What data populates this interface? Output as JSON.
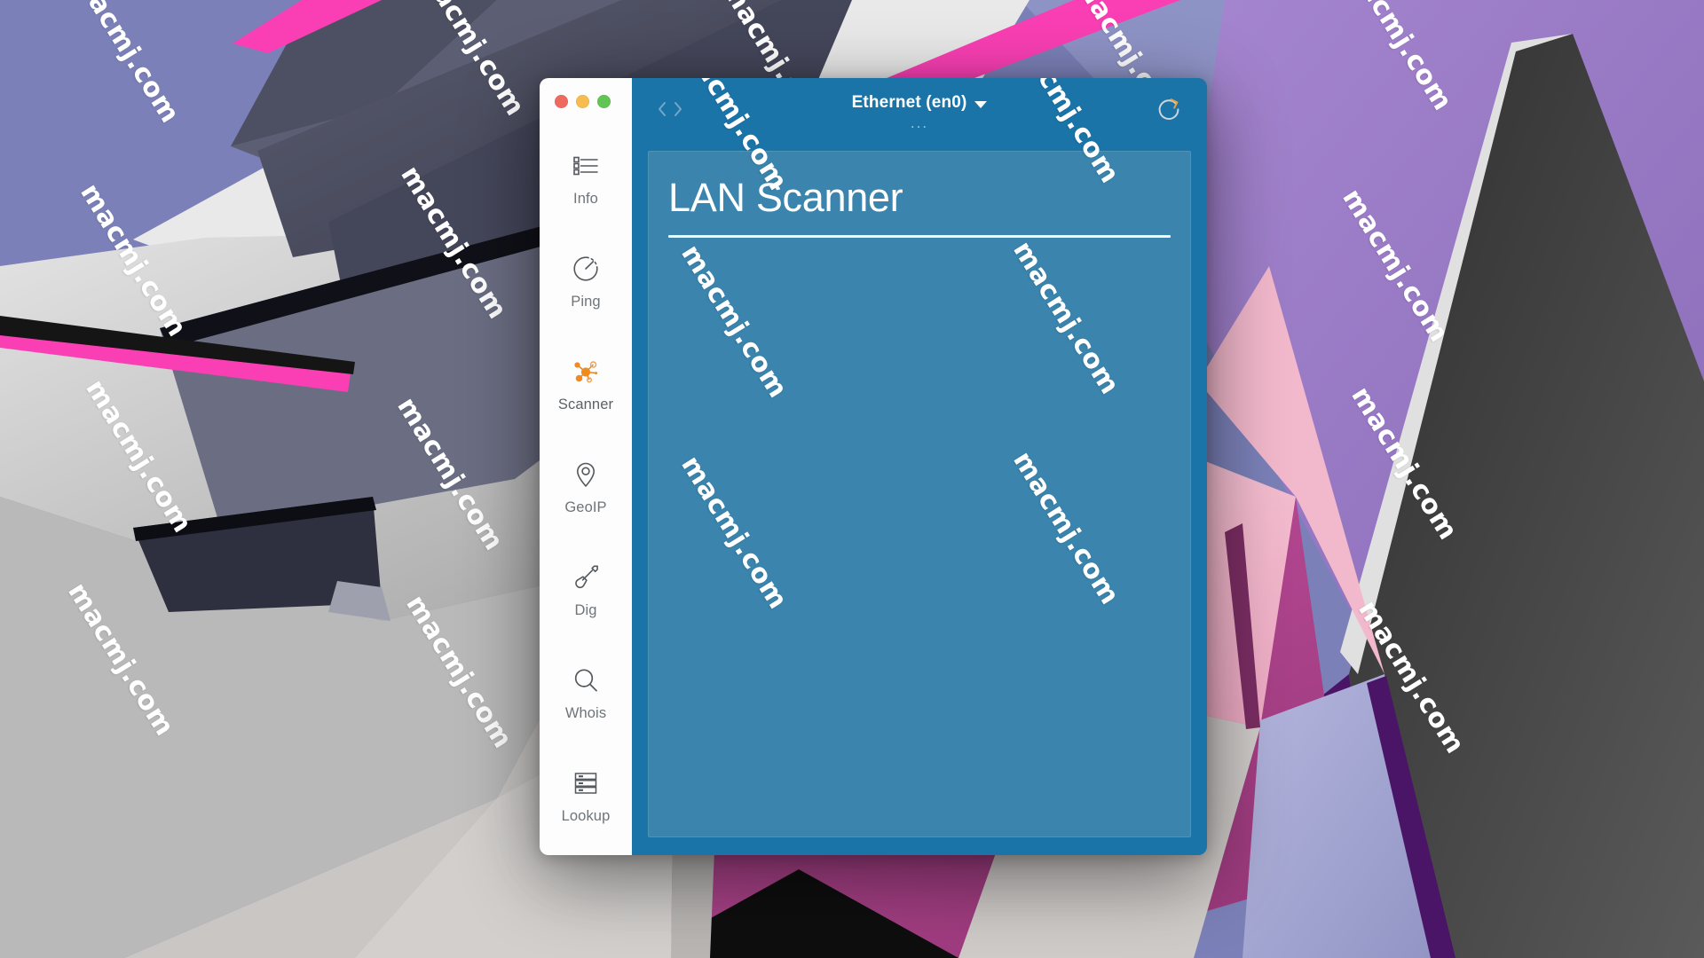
{
  "desktop": {
    "watermark_text": "macmj.com",
    "wallpaper_colors": {
      "periwinkle": "#7b80b8",
      "light_gray": "#d5d5d5",
      "mid_gray": "#6d7185",
      "dark_slate": "#4a4c5e",
      "charcoal": "#3a3a3a",
      "purple": "#9b7cc4",
      "pink": "#f2b8cc",
      "magenta": "#b0458f",
      "hot_pink": "#fa3fb4",
      "deep_purple": "#4a1566",
      "lavender": "#aeb0d8",
      "near_black": "#121212"
    }
  },
  "window": {
    "traffic_lights": [
      {
        "name": "close",
        "color": "#ee6a5f"
      },
      {
        "name": "minimize",
        "color": "#f5bd4f"
      },
      {
        "name": "zoom",
        "color": "#61c454"
      }
    ],
    "accent_color": "#e8851f",
    "header_color": "#1b74a8",
    "panel_color": "#3a84ad"
  },
  "sidebar": {
    "items": [
      {
        "label": "Info",
        "icon": "list-icon",
        "active": false
      },
      {
        "label": "Ping",
        "icon": "gauge-icon",
        "active": false
      },
      {
        "label": "Scanner",
        "icon": "network-icon",
        "active": true
      },
      {
        "label": "GeoIP",
        "icon": "pin-icon",
        "active": false
      },
      {
        "label": "Dig",
        "icon": "shovel-icon",
        "active": false
      },
      {
        "label": "Whois",
        "icon": "search-icon",
        "active": false
      },
      {
        "label": "Lookup",
        "icon": "server-icon",
        "active": false
      }
    ]
  },
  "titlebar": {
    "code_icon": "code-brackets-icon",
    "interface_name": "Ethernet (en0)",
    "interface_subtitle": "...",
    "caret_icon": "chevron-down-icon",
    "refresh_icon": "refresh-icon"
  },
  "main": {
    "title": "LAN Scanner"
  }
}
